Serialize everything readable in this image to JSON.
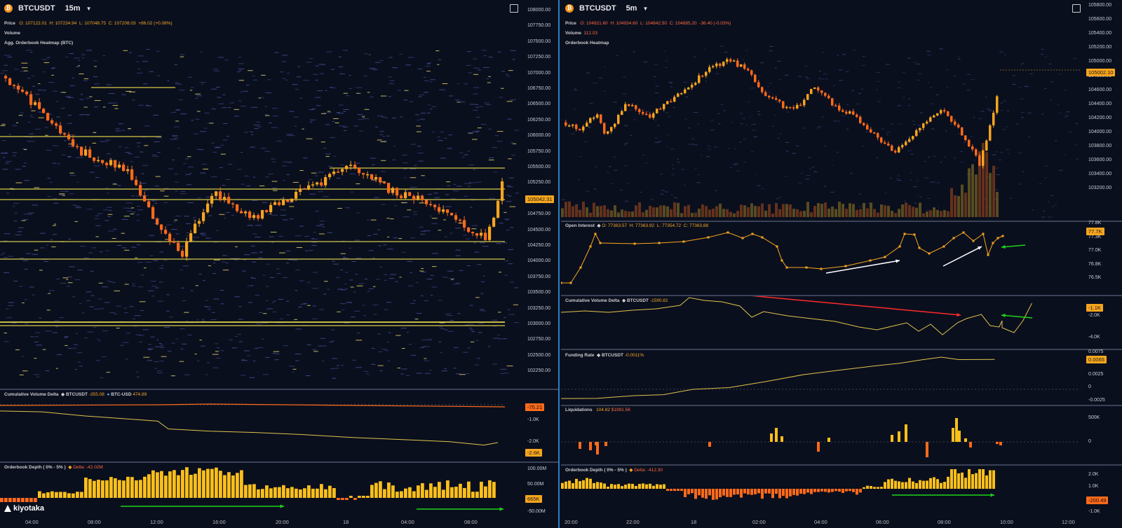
{
  "left": {
    "symbol": "BTCUSDT",
    "timeframe": "15m",
    "price_line": {
      "label": "Price",
      "o": "O: 107122.01",
      "h": "H: 107234.94",
      "l": "L: 107048.75",
      "c": "C: 107208.03",
      "chg": "+86.02 (+0.08%)"
    },
    "volume_label": "Volume",
    "heatmap_label": "Agg. Orderbook Heatmap (BTC)",
    "price_axis": [
      "108000.00",
      "107750.00",
      "107500.00",
      "107250.00",
      "107000.00",
      "106750.00",
      "106500.00",
      "106250.00",
      "106000.00",
      "105750.00",
      "105500.00",
      "105250.00",
      "105000.00",
      "104750.00",
      "104500.00",
      "104250.00",
      "104000.00",
      "103750.00",
      "103500.00",
      "103250.00",
      "103000.00",
      "102750.00",
      "102500.00",
      "102250.00"
    ],
    "price_tag": "105042.31",
    "cvd": {
      "label": "Cumulative Volume Delta",
      "s1": "BTCUSDT",
      "s1v": "-355.08",
      "s2": "BTC-USD",
      "s2v": "474.89",
      "axis": [
        "-1.0K",
        "-2.0K"
      ],
      "tag1": "-75.21",
      "tag2": "-2.6K"
    },
    "depth": {
      "label": "Orderbook Depth ( 0% - 5% )",
      "delta": "Delta: -42.02M",
      "axis": [
        "100.00M",
        "50.00M",
        "-50.00M"
      ],
      "tag": "665K"
    },
    "xaxis": [
      "04:00",
      "08:00",
      "12:00",
      "16:00",
      "20:00",
      "18",
      "04:00",
      "08:00"
    ],
    "logo": "kiyotaka"
  },
  "right": {
    "symbol": "BTCUSDT",
    "timeframe": "5m",
    "price_line": {
      "label": "Price",
      "o": "O: 104921.60",
      "h": "H: 104934.60",
      "l": "L: 104842.50",
      "c": "C: 104885.20",
      "chg": "-36.40 (-0.03%)"
    },
    "volume_label": "Volume",
    "volume_value": "112.03",
    "heatmap_label": "Orderbook Heatmap",
    "price_axis": [
      "105800.00",
      "105600.00",
      "105400.00",
      "105200.00",
      "105000.00",
      "104800.00",
      "104600.00",
      "104400.00",
      "104200.00",
      "104000.00",
      "103800.00",
      "103600.00",
      "103400.00",
      "103200.00"
    ],
    "price_tag": "105002.10",
    "oi": {
      "label": "Open Interest",
      "o": "O: 77363.57",
      "h": "H: 77363.92",
      "l": "L: 77354.72",
      "c": "C: 77363.88",
      "axis": [
        "77.8K",
        "77.3K",
        "77.0K",
        "76.8K",
        "76.5K"
      ],
      "tag": "77.7K"
    },
    "cvd": {
      "label": "Cumulative Volume Delta",
      "s1": "BTCUSDT",
      "s1v": "-1590.82",
      "axis": [
        "-2.0K",
        "-4.0K"
      ],
      "tag": "-1.1K"
    },
    "funding": {
      "label": "Funding Rate",
      "s1": "BTCUSDT",
      "s1v": "-0.0011%",
      "axis": [
        "0.0075",
        "0.0025",
        "0",
        "-0.0025"
      ],
      "tag": "0.0065"
    },
    "liq": {
      "label": "Liquidations",
      "v1": "104.82",
      "v2": "$1991.56",
      "axis": [
        "500K",
        "0"
      ]
    },
    "depth": {
      "label": "Orderbook Depth ( 0% - 5% )",
      "delta": "Delta: -412.30",
      "axis": [
        "2.0K",
        "1.0K",
        "-1.0K"
      ],
      "tag": "-200.49"
    },
    "xaxis": [
      "20:00",
      "22:00",
      "18",
      "02:00",
      "04:00",
      "06:00",
      "08:00",
      "10:00",
      "12:00"
    ]
  },
  "colors": {
    "bg": "#0a0f1e",
    "candle": "#f7a51e",
    "candle_down": "#ff6a1a",
    "arrow_green": "#1ed418",
    "arrow_red": "#ff2a2a",
    "divider": "#2a7fc2"
  }
}
